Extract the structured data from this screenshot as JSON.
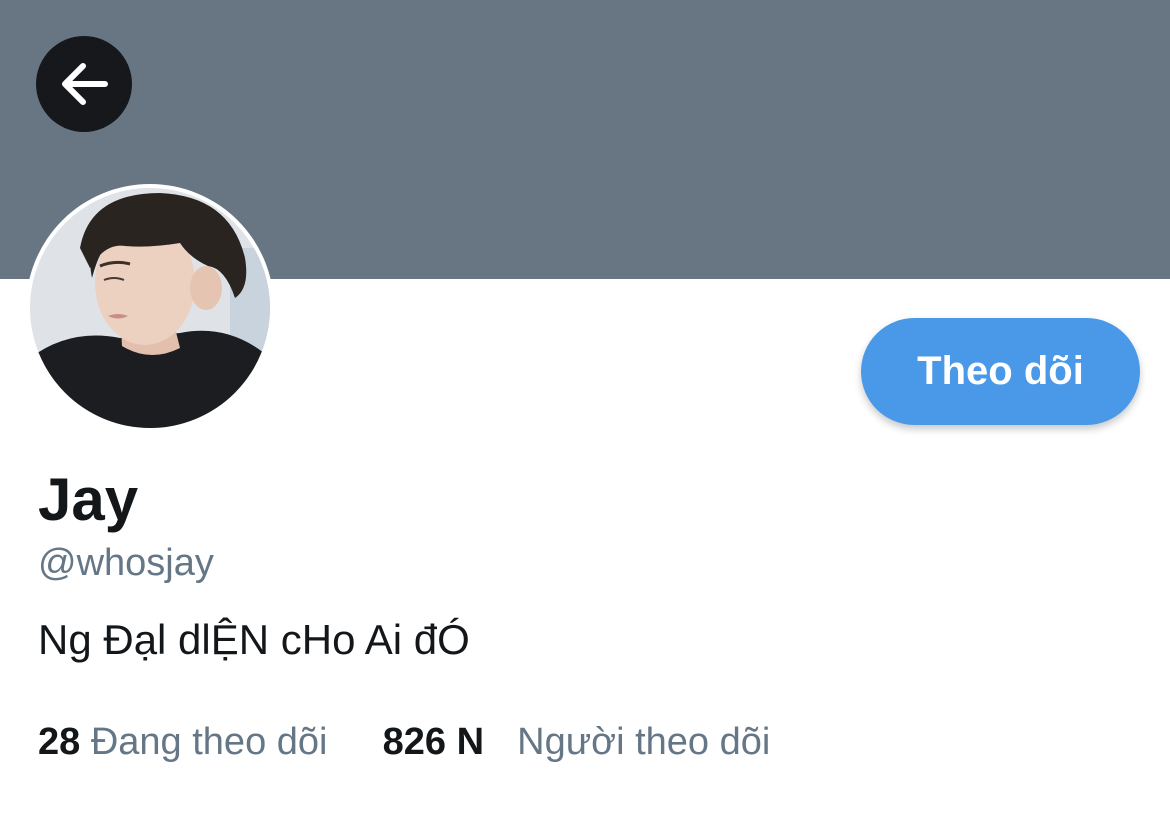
{
  "header": {
    "back_icon": "arrow-left-icon",
    "banner_color": "#687684"
  },
  "profile": {
    "display_name": "Jay",
    "handle": "@whosjay",
    "bio": "Ng Đạl dlỆN cHo Ai đÓ",
    "follow_button_label": "Theo dõi",
    "follow_button_color": "#4a99e9"
  },
  "stats": {
    "following_count": "28",
    "following_label": "Đang theo dõi",
    "followers_count": "826 N",
    "followers_label": "Người theo dõi"
  },
  "colors": {
    "text_primary": "#14171a",
    "text_secondary": "#657786"
  }
}
